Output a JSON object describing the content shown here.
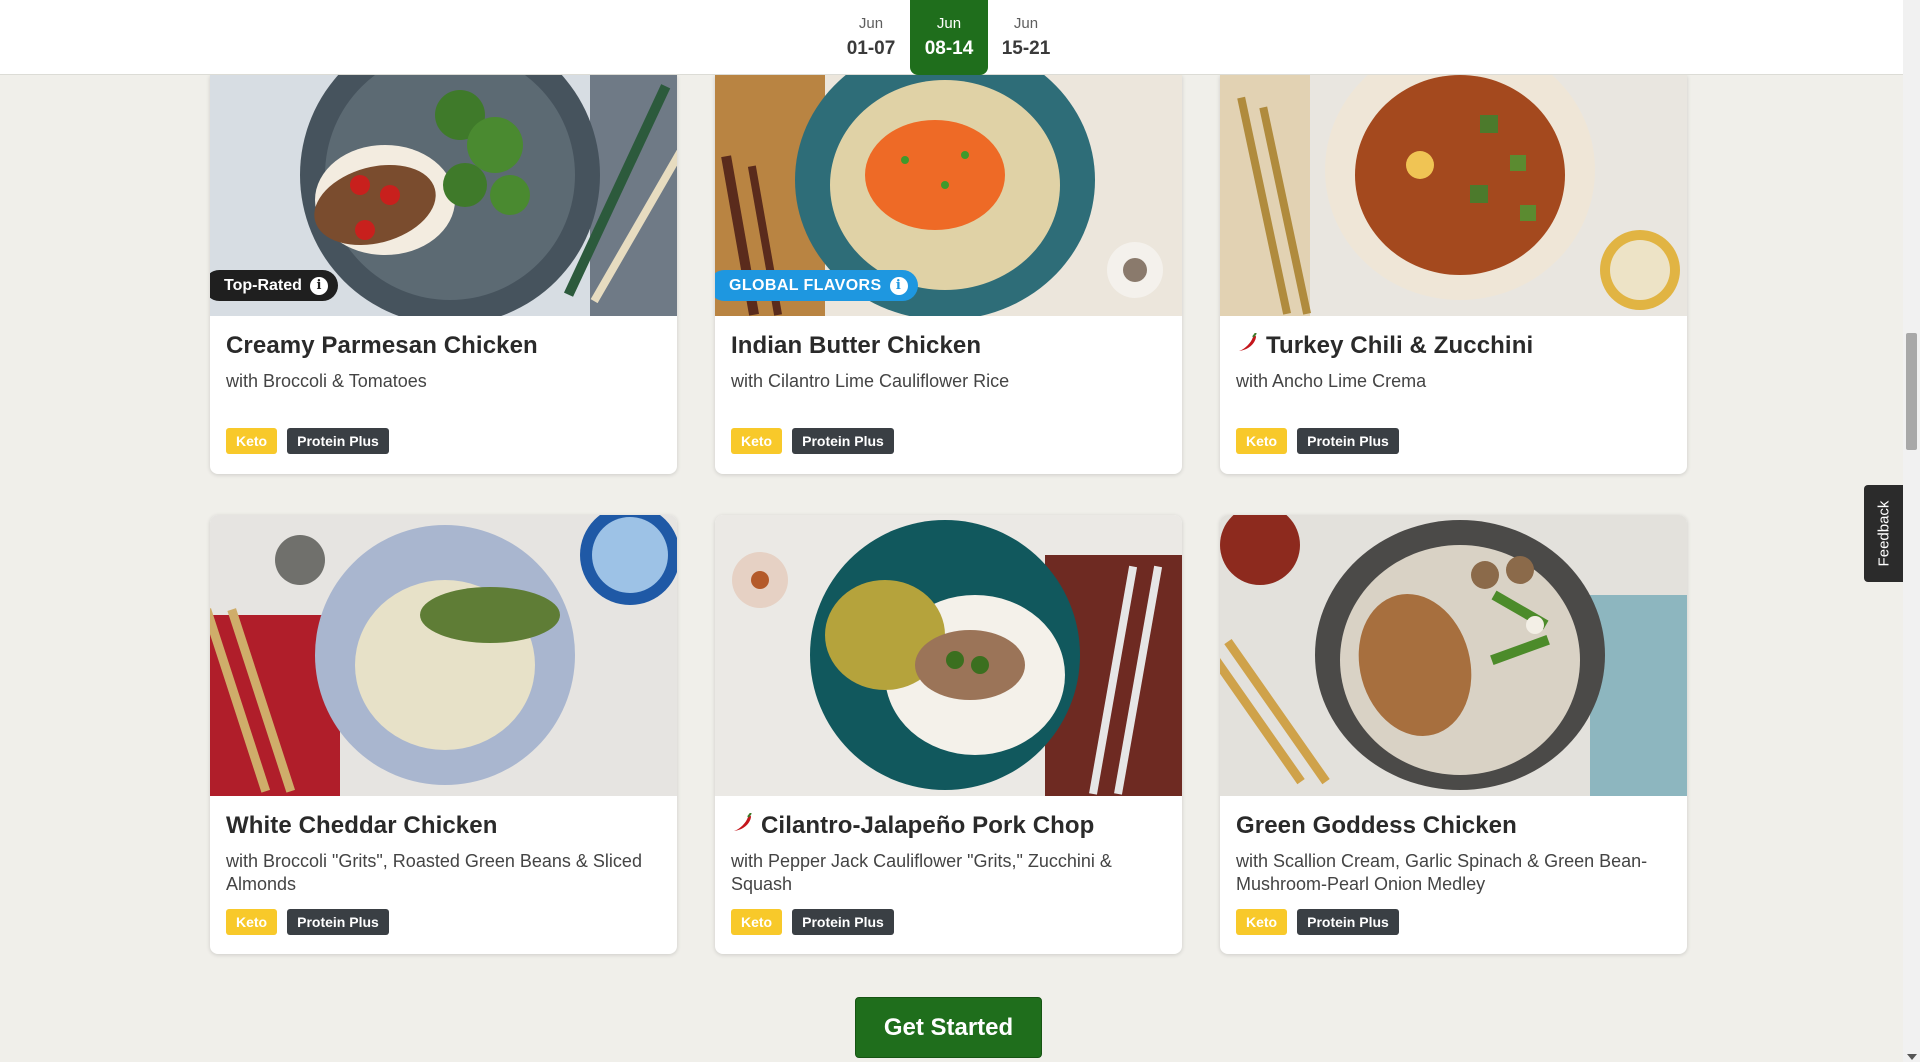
{
  "weeks": [
    {
      "month": "Jun",
      "range": "01-07",
      "active": false
    },
    {
      "month": "Jun",
      "range": "08-14",
      "active": true
    },
    {
      "month": "Jun",
      "range": "15-21",
      "active": false
    }
  ],
  "meals": [
    {
      "title": "Creamy Parmesan Chicken",
      "subtitle": "with Broccoli & Tomatoes",
      "badge": "Top-Rated",
      "spicy": false,
      "tags": [
        "Keto",
        "Protein Plus"
      ]
    },
    {
      "title": "Indian Butter Chicken",
      "subtitle": "with Cilantro Lime Cauliflower Rice",
      "badge": "GLOBAL FLAVORS",
      "spicy": false,
      "tags": [
        "Keto",
        "Protein Plus"
      ]
    },
    {
      "title": "Turkey Chili & Zucchini",
      "subtitle": "with Ancho Lime Crema",
      "spicy": true,
      "tags": [
        "Keto",
        "Protein Plus"
      ]
    },
    {
      "title": "White Cheddar Chicken",
      "subtitle": "with Broccoli \"Grits\", Roasted Green Beans & Sliced Almonds",
      "spicy": false,
      "tags": [
        "Keto",
        "Protein Plus"
      ]
    },
    {
      "title": "Cilantro-Jalapeño Pork Chop",
      "subtitle": "with Pepper Jack Cauliflower \"Grits,\" Zucchini & Squash",
      "spicy": true,
      "tags": [
        "Keto",
        "Protein Plus"
      ]
    },
    {
      "title": "Green Goddess Chicken",
      "subtitle": "with Scallion Cream, Garlic Spinach & Green Bean-Mushroom-Pearl Onion Medley",
      "spicy": false,
      "tags": [
        "Keto",
        "Protein Plus"
      ]
    }
  ],
  "cta_label": "Get Started",
  "feedback_label": "Feedback",
  "colors": {
    "brand_green": "#1f6e1c",
    "keto_yellow": "#f8c92a",
    "protein_dark": "#3a3f44",
    "global_blue": "#1e97e0"
  },
  "icons": {
    "info": "info-icon",
    "spicy": "chili-pepper-icon"
  }
}
